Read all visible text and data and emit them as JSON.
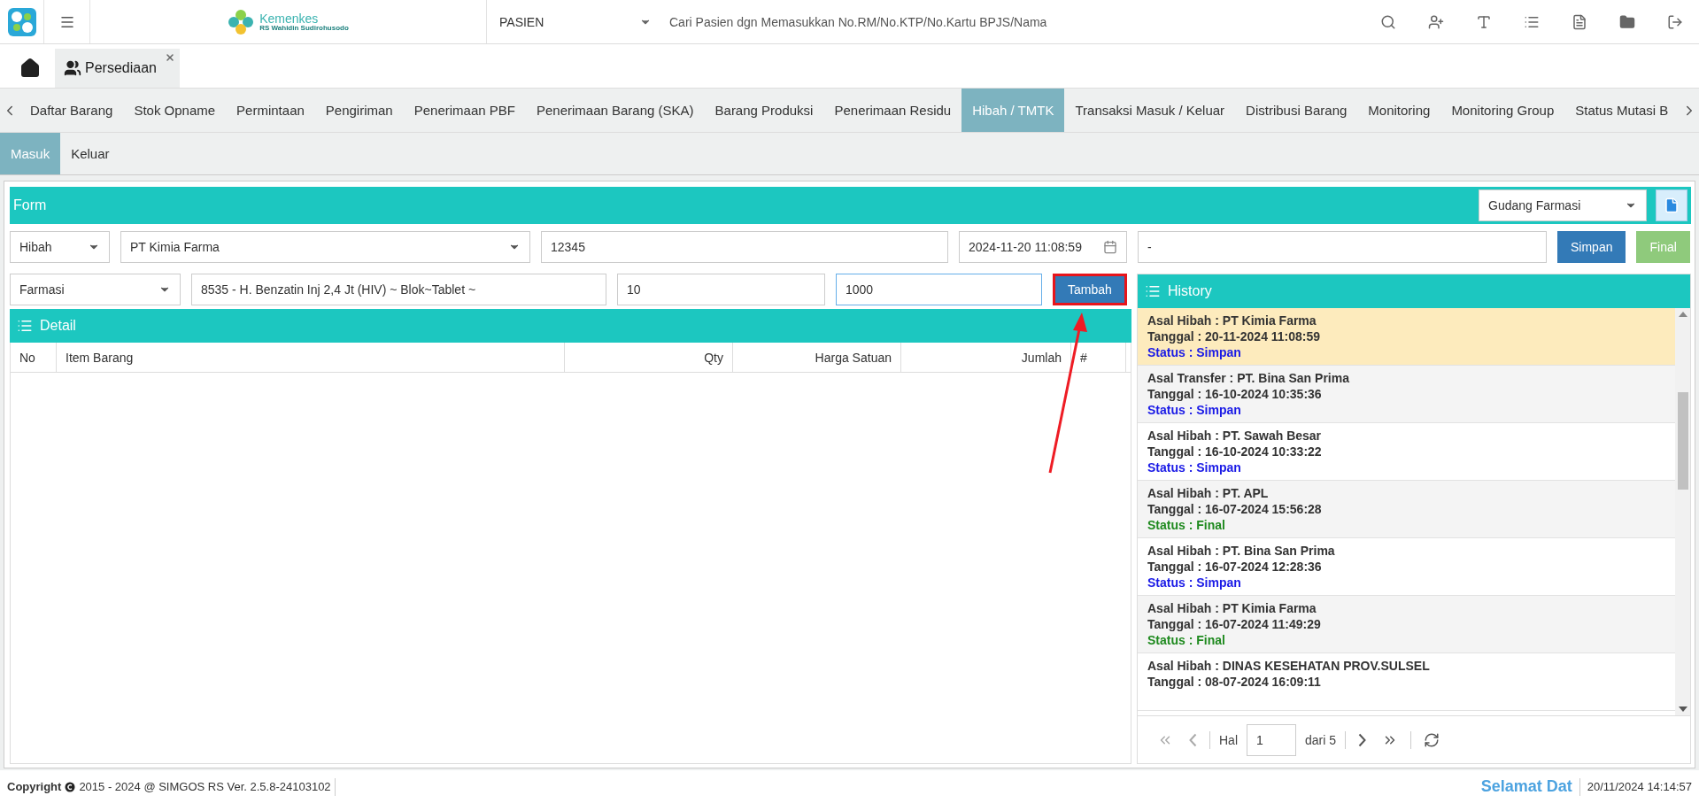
{
  "header": {
    "brand": {
      "name": "Kemenkes",
      "subtitle": "RS Wahidin Sudirohusodo"
    },
    "search_category": "PASIEN",
    "search_placeholder": "Cari Pasien dgn Memasukkan No.RM/No.KTP/No.Kartu BPJS/Nama"
  },
  "open_tabs": [
    {
      "label": "Persediaan",
      "selected": true
    }
  ],
  "module_tabs": [
    {
      "label": "Daftar Barang",
      "selected": false
    },
    {
      "label": "Stok Opname",
      "selected": false
    },
    {
      "label": "Permintaan",
      "selected": false
    },
    {
      "label": "Pengiriman",
      "selected": false
    },
    {
      "label": "Penerimaan PBF",
      "selected": false
    },
    {
      "label": "Penerimaan Barang (SKA)",
      "selected": false
    },
    {
      "label": "Barang Produksi",
      "selected": false
    },
    {
      "label": "Penerimaan Residu",
      "selected": false
    },
    {
      "label": "Hibah / TMTK",
      "selected": true
    },
    {
      "label": "Transaksi Masuk / Keluar",
      "selected": false
    },
    {
      "label": "Distribusi Barang",
      "selected": false
    },
    {
      "label": "Monitoring",
      "selected": false
    },
    {
      "label": "Monitoring Group",
      "selected": false
    },
    {
      "label": "Status Mutasi B",
      "selected": false
    }
  ],
  "sub_tabs": [
    {
      "label": "Masuk",
      "selected": true
    },
    {
      "label": "Keluar",
      "selected": false
    }
  ],
  "form": {
    "title": "Form",
    "warehouse": "Gudang Farmasi",
    "row1": [
      {
        "kind": "select",
        "value": "Hibah"
      },
      {
        "kind": "select",
        "value": "PT Kimia Farma"
      },
      {
        "kind": "input",
        "value": "12345"
      },
      {
        "kind": "date",
        "value": "2024-11-20 11:08:59"
      },
      {
        "kind": "input",
        "value": "-"
      }
    ],
    "row1_buttons": [
      {
        "label": "Simpan",
        "kind": "primary"
      },
      {
        "label": "Final",
        "kind": "success"
      }
    ],
    "row2": [
      {
        "kind": "select",
        "value": "Farmasi",
        "focused": false
      },
      {
        "kind": "input",
        "value": "8535 - H. Benzatin Inj 2,4 Jt (HIV) ~ Blok~Tablet ~",
        "focused": false
      },
      {
        "kind": "input",
        "value": "10",
        "focused": false
      },
      {
        "kind": "input",
        "value": "1000",
        "focused": true
      }
    ],
    "add_button": {
      "label": "Tambah",
      "highlighted": true
    }
  },
  "detail": {
    "title": "Detail",
    "columns": [
      "No",
      "Item Barang",
      "Qty",
      "Harga Satuan",
      "Jumlah",
      "#"
    ]
  },
  "history": {
    "title": "History",
    "items": [
      {
        "selected": true,
        "origin": "Asal Hibah : PT Kimia Farma",
        "date": "Tanggal : 20-11-2024 11:08:59",
        "status": {
          "text": "Status : Simpan",
          "kind": "simpan"
        }
      },
      {
        "selected": false,
        "origin": "Asal Transfer : PT. Bina San Prima",
        "date": "Tanggal : 16-10-2024 10:35:36",
        "status": {
          "text": "Status : Simpan",
          "kind": "simpan"
        }
      },
      {
        "selected": false,
        "origin": "Asal Hibah : PT. Sawah Besar",
        "date": "Tanggal : 16-10-2024 10:33:22",
        "status": {
          "text": "Status : Simpan",
          "kind": "simpan"
        }
      },
      {
        "selected": false,
        "origin": "Asal Hibah : PT. APL",
        "date": "Tanggal : 16-07-2024 15:56:28",
        "status": {
          "text": "Status : Final",
          "kind": "final"
        }
      },
      {
        "selected": false,
        "origin": "Asal Hibah : PT. Bina San Prima",
        "date": "Tanggal : 16-07-2024 12:28:36",
        "status": {
          "text": "Status : Simpan",
          "kind": "simpan"
        }
      },
      {
        "selected": false,
        "origin": "Asal Hibah : PT Kimia Farma",
        "date": "Tanggal : 16-07-2024 11:49:29",
        "status": {
          "text": "Status : Final",
          "kind": "final"
        }
      },
      {
        "selected": false,
        "origin": "Asal Hibah : DINAS KESEHATAN PROV.SULSEL",
        "date": "Tanggal : 08-07-2024 16:09:11"
      }
    ],
    "pager": {
      "label": "Hal",
      "page": "1",
      "total": "dari 5"
    }
  },
  "footer": {
    "copyright_label": "Copyright",
    "copyright_text": "2015 - 2024 @ SIMGOS RS Ver. 2.5.8-24103102",
    "marquee": "Selamat Dat",
    "datetime": "20/11/2024 14:14:57"
  }
}
